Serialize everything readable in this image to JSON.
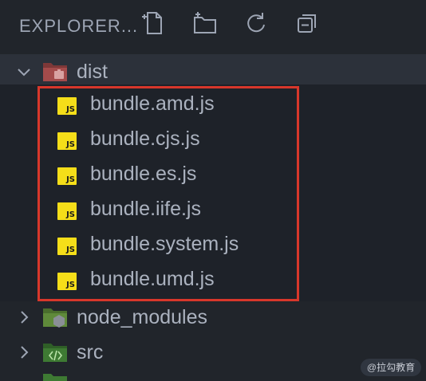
{
  "header": {
    "title": "EXPLORER..."
  },
  "tree": {
    "dist": {
      "label": "dist"
    },
    "files": [
      {
        "label": "bundle.amd.js",
        "badge": "JS"
      },
      {
        "label": "bundle.cjs.js",
        "badge": "JS"
      },
      {
        "label": "bundle.es.js",
        "badge": "JS"
      },
      {
        "label": "bundle.iife.js",
        "badge": "JS"
      },
      {
        "label": "bundle.system.js",
        "badge": "JS"
      },
      {
        "label": "bundle.umd.js",
        "badge": "JS"
      }
    ],
    "node_modules": {
      "label": "node_modules"
    },
    "src": {
      "label": "src"
    }
  },
  "watermark": "@拉勾教育",
  "colors": {
    "highlight": "#d8372b",
    "js_badge": "#f5de19",
    "dist_folder": "#a44b4b",
    "node_folder": "#5f8a3a",
    "src_folder": "#3e7a33"
  }
}
